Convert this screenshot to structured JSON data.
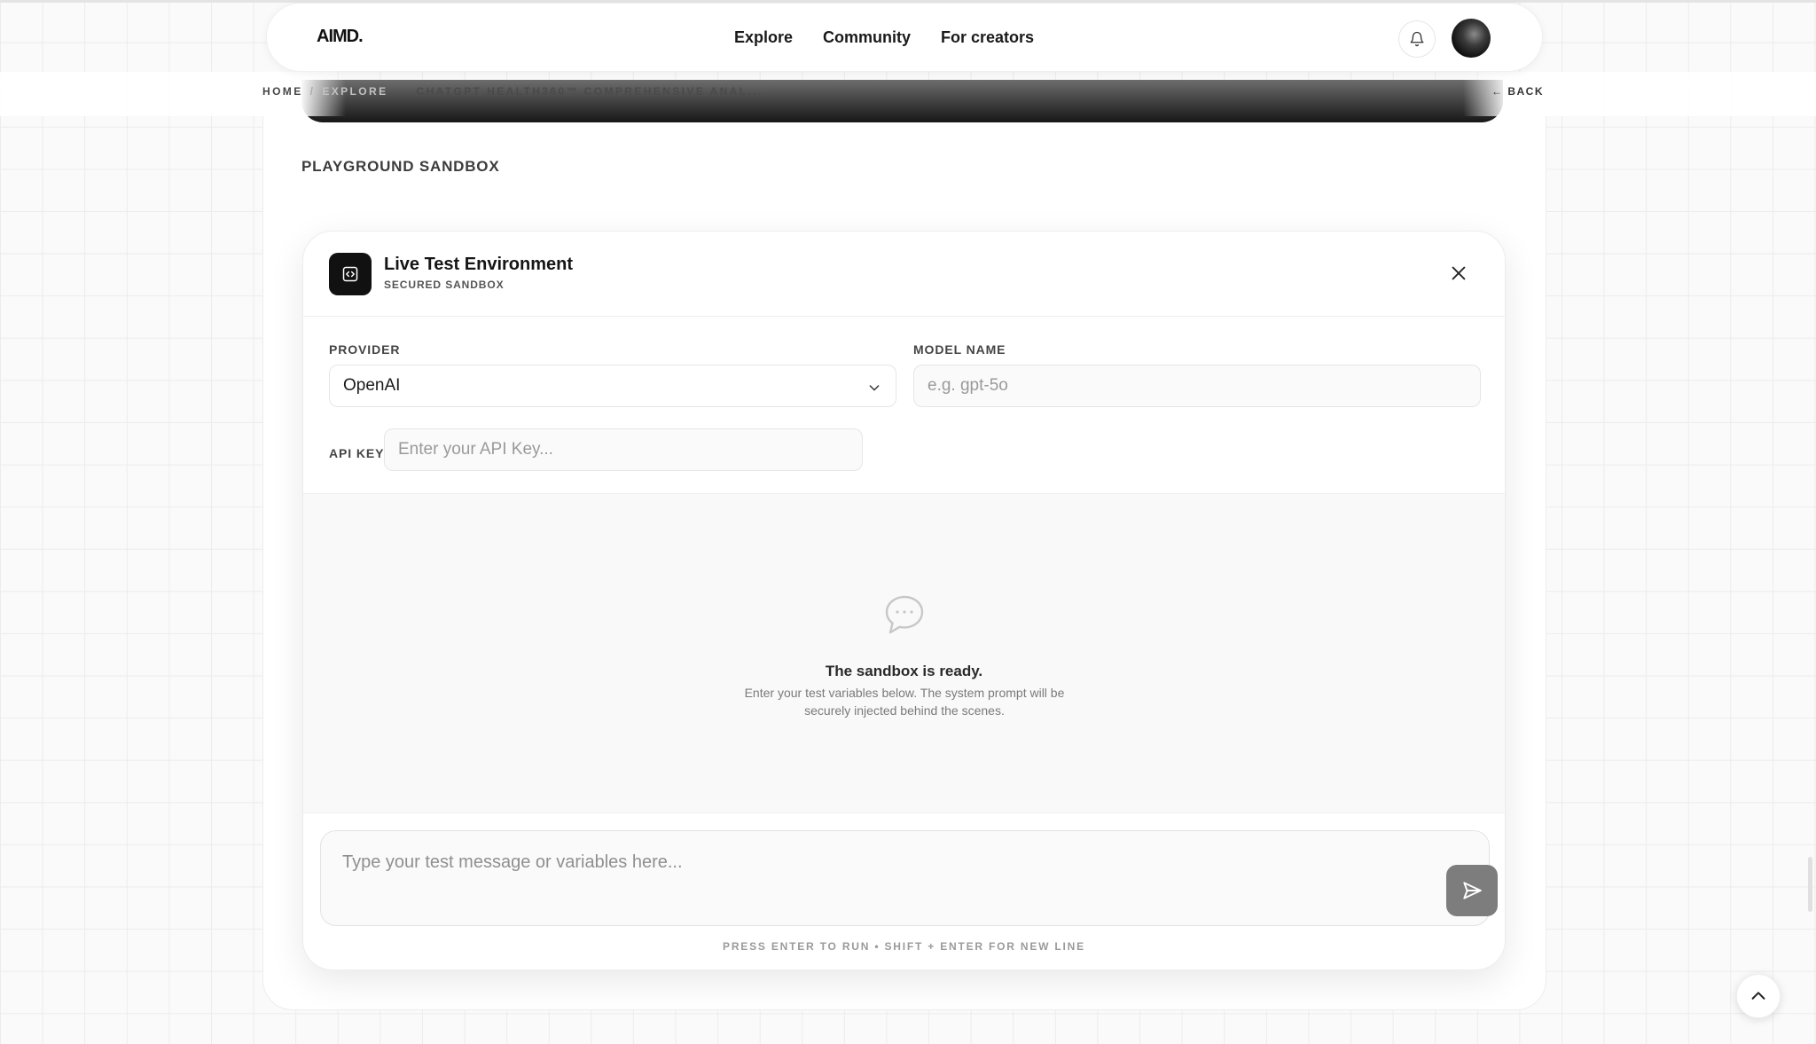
{
  "nav": {
    "logo": "AIMD.",
    "links": [
      "Explore",
      "Community",
      "For creators"
    ]
  },
  "breadcrumb": {
    "home": "HOME",
    "separator": "/",
    "explore": "EXPLORE",
    "current": "CHATGPT HEALTH360™ COMPREHENSIVE ANAL..."
  },
  "back_label": "← BACK",
  "section_title": "PLAYGROUND SANDBOX",
  "sandbox": {
    "title": "Live Test Environment",
    "subtitle": "SECURED SANDBOX",
    "provider_label": "PROVIDER",
    "provider_value": "OpenAI",
    "model_label": "MODEL NAME",
    "model_placeholder": "e.g. gpt-5o",
    "api_label": "API KEY",
    "api_placeholder": "Enter your API Key...",
    "ready_title": "The sandbox is ready.",
    "ready_body": "Enter your test variables below. The system prompt will be securely injected behind the scenes.",
    "composer_placeholder": "Type your test message or variables here...",
    "hint": "PRESS ENTER TO RUN • SHIFT + ENTER FOR NEW LINE"
  },
  "colors": {
    "accent": "#111111",
    "send_button": "#7d7d7d",
    "background": "#fafafa"
  },
  "icons": [
    "bell-icon",
    "avatar",
    "code-icon",
    "close-icon",
    "chevron-down-icon",
    "chat-bubble-icon",
    "send-icon",
    "chevron-up-icon"
  ]
}
